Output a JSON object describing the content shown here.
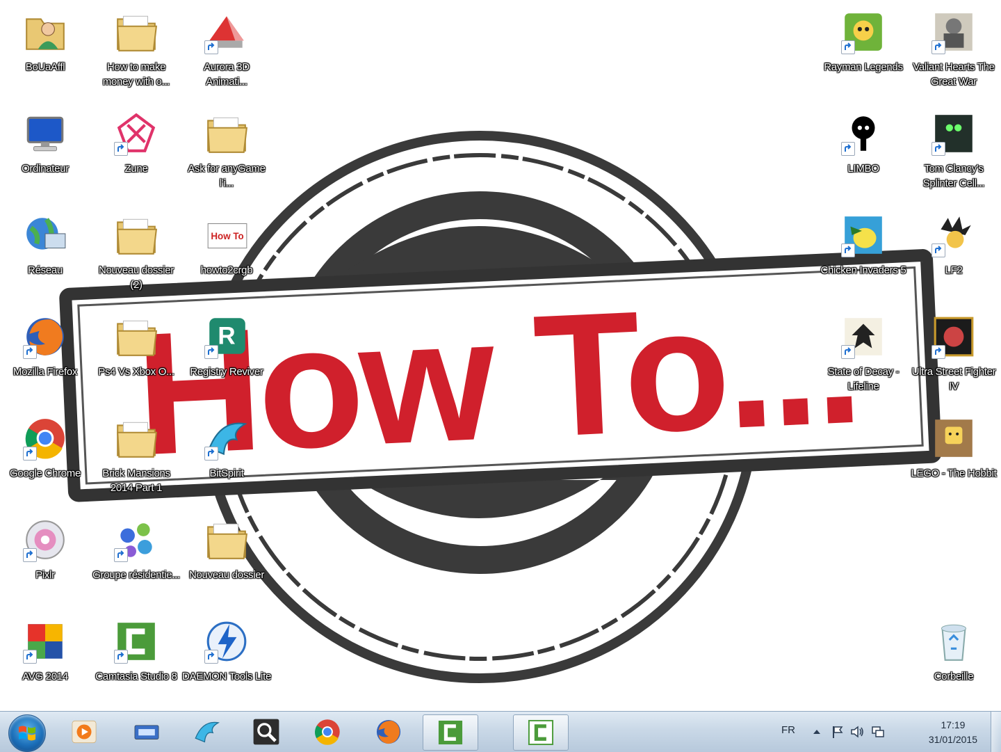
{
  "wallpaper": {
    "logo_text": "How To...",
    "accent": "#d0202c",
    "ring_color": "#3a3a3a"
  },
  "desktop": {
    "icons": [
      {
        "label": "BoUaAffl",
        "icon": "user-folder-icon"
      },
      {
        "label": "How to make money with o...",
        "icon": "folder-icon"
      },
      {
        "label": "Aurora 3D Animati...",
        "icon": "aurora-3d-icon"
      },
      {
        "label": "Rayman Legends",
        "icon": "rayman-icon"
      },
      {
        "label": "Valiant Hearts The Great War",
        "icon": "valiant-hearts-icon"
      },
      {
        "label": "Ordinateur",
        "icon": "computer-icon"
      },
      {
        "label": "Zune",
        "icon": "zune-icon"
      },
      {
        "label": "Ask for anyGame l'i...",
        "icon": "folder-icon"
      },
      {
        "label": "LIMBO",
        "icon": "limbo-icon"
      },
      {
        "label": "Tom Clancy's Splinter Cell...",
        "icon": "splinter-cell-icon"
      },
      {
        "label": "Réseau",
        "icon": "network-icon"
      },
      {
        "label": "Nouveau dossier (2)",
        "icon": "folder-icon"
      },
      {
        "label": "howto2crgb",
        "icon": "image-file-icon"
      },
      {
        "label": "Chicken Invaders 5",
        "icon": "chicken-invaders-icon"
      },
      {
        "label": "LF2",
        "icon": "lf2-icon"
      },
      {
        "label": "Mozilla Firefox",
        "icon": "firefox-icon"
      },
      {
        "label": "Ps4 Vs Xbox O...",
        "icon": "folder-icon"
      },
      {
        "label": "Registry Reviver",
        "icon": "registry-reviver-icon"
      },
      {
        "label": "State of Decay - Lifeline",
        "icon": "state-of-decay-icon"
      },
      {
        "label": "Ultra Street Fighter IV",
        "icon": "street-fighter-icon"
      },
      {
        "label": "Google Chrome",
        "icon": "chrome-icon"
      },
      {
        "label": "Brick Mansions 2014  Part 1",
        "icon": "folder-icon"
      },
      {
        "label": "BitSpirit",
        "icon": "bitspirit-icon"
      },
      {
        "label": "LEGO - The Hobbit",
        "icon": "lego-hobbit-icon"
      },
      {
        "label": "Pixlr",
        "icon": "pixlr-icon"
      },
      {
        "label": "Groupe résidentie...",
        "icon": "homegroup-icon"
      },
      {
        "label": "Nouveau dossier",
        "icon": "folder-icon"
      },
      {
        "label": "AVG 2014",
        "icon": "avg-icon"
      },
      {
        "label": "Camtasia Studio 8",
        "icon": "camtasia-icon"
      },
      {
        "label": "DAEMON Tools Lite",
        "icon": "daemon-tools-icon"
      },
      {
        "label": "Corbeille",
        "icon": "recycle-bin-icon"
      }
    ]
  },
  "taskbar": {
    "pinned": [
      {
        "name": "media-player-icon"
      },
      {
        "name": "device-manager-icon"
      },
      {
        "name": "bitspirit-icon"
      },
      {
        "name": "magnifier-icon"
      },
      {
        "name": "chrome-icon"
      },
      {
        "name": "firefox-icon"
      },
      {
        "name": "camtasia-icon"
      },
      {
        "name": "camtasia-recorder-icon"
      }
    ],
    "tray": {
      "language": "FR",
      "time": "17:19",
      "date": "31/01/2015"
    }
  }
}
